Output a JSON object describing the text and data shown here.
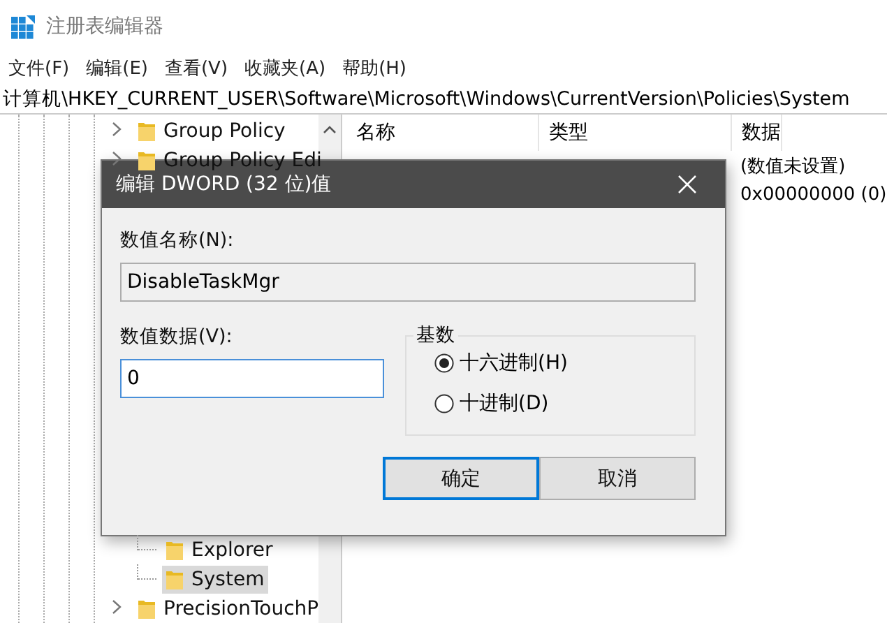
{
  "window": {
    "title": "注册表编辑器"
  },
  "menu": [
    "文件(F)",
    "编辑(E)",
    "查看(V)",
    "收藏夹(A)",
    "帮助(H)"
  ],
  "address": "计算机\\HKEY_CURRENT_USER\\Software\\Microsoft\\Windows\\CurrentVersion\\Policies\\System",
  "tree": {
    "items": [
      {
        "label": "Group Policy",
        "has_children": true,
        "selected": false
      },
      {
        "label": "Group Policy Edi",
        "has_children": true,
        "selected": false
      },
      {
        "children": [
          {
            "label": "Explorer",
            "selected": false
          },
          {
            "label": "System",
            "selected": true
          }
        ]
      },
      {
        "label": "PrecisionTouchP",
        "has_children": true,
        "selected": false
      }
    ]
  },
  "list": {
    "columns": [
      "名称",
      "类型",
      "数据"
    ],
    "rows": [
      {
        "data": "(数值未设置)"
      },
      {
        "data": "0x00000000 (0)"
      }
    ]
  },
  "dialog": {
    "title": "编辑 DWORD (32 位)值",
    "name_label": "数值名称(N):",
    "name_value": "DisableTaskMgr",
    "data_label": "数值数据(V):",
    "data_value": "0",
    "base_label": "基数",
    "radios": [
      {
        "label": "十六进制(H)",
        "selected": true
      },
      {
        "label": "十进制(D)",
        "selected": false
      }
    ],
    "buttons": [
      {
        "label": "确定",
        "default": true
      },
      {
        "label": "取消",
        "default": false
      }
    ]
  }
}
